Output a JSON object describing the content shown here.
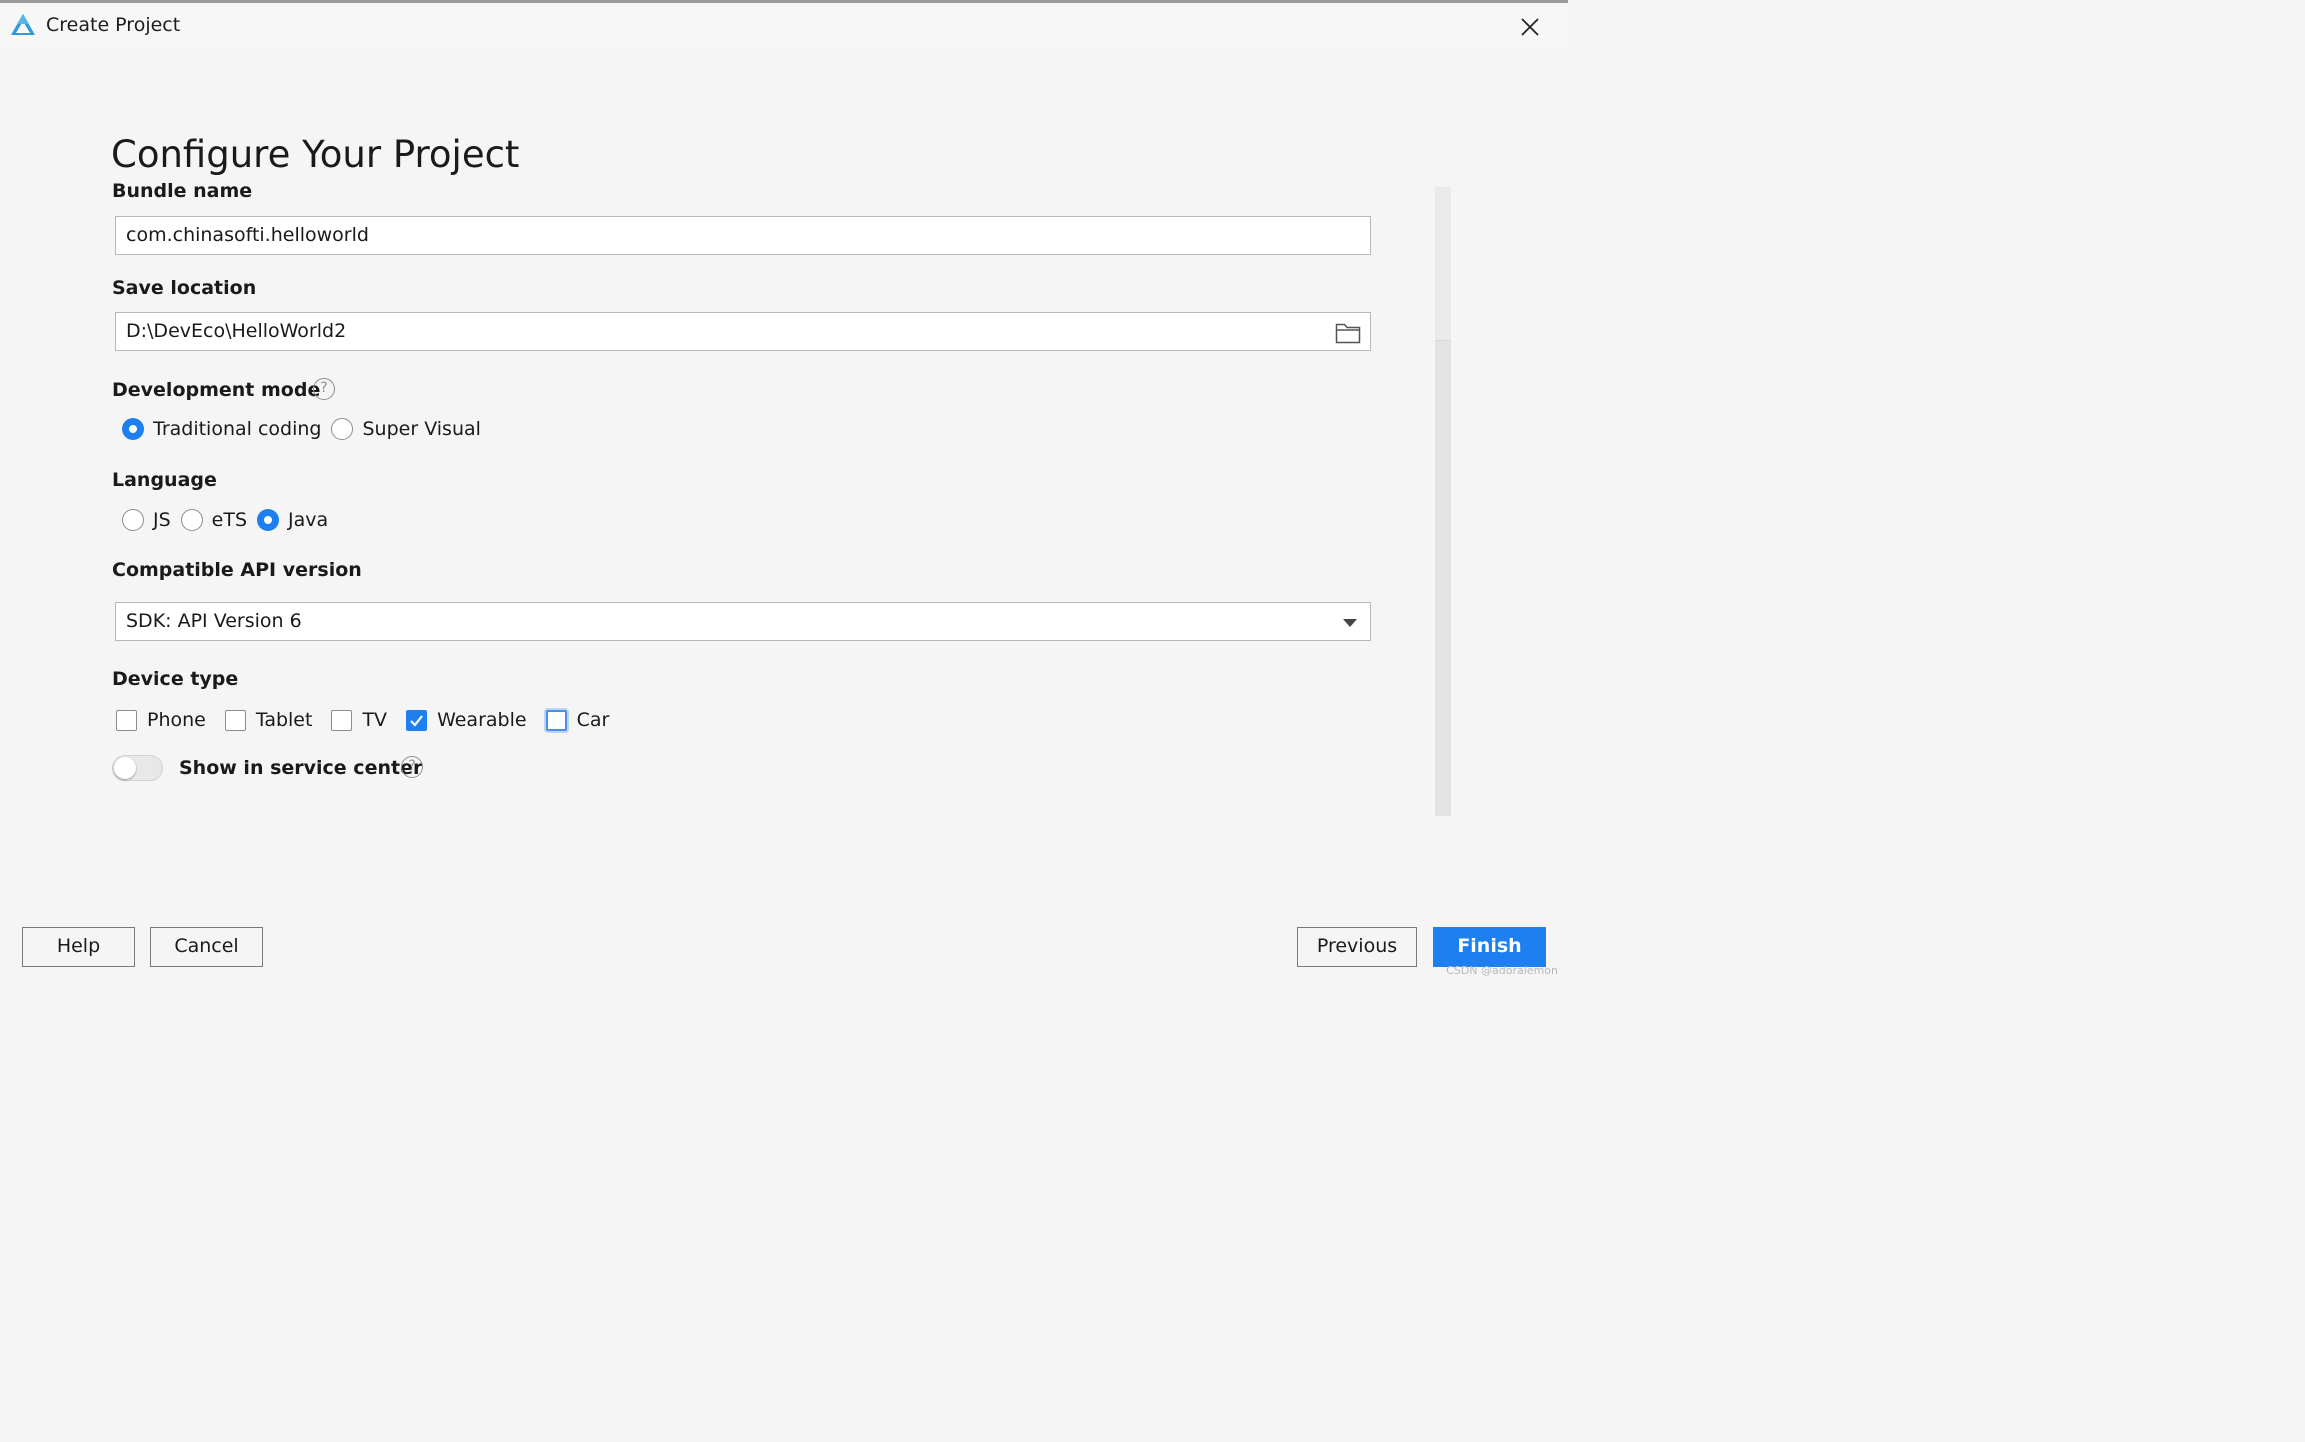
{
  "window": {
    "title": "Create Project",
    "logo_icon": "deveco-triangle-logo",
    "close_icon": "close-x-icon"
  },
  "page": {
    "heading": "Configure Your Project"
  },
  "form": {
    "bundle_name": {
      "label": "Bundle name",
      "value": "com.chinasofti.helloworld"
    },
    "save_location": {
      "label": "Save location",
      "value": "D:\\DevEco\\HelloWorld2",
      "browse_icon": "folder-icon"
    },
    "development_mode": {
      "label": "Development mode",
      "help_icon": "?",
      "options": [
        {
          "label": "Traditional coding",
          "checked": true
        },
        {
          "label": "Super Visual",
          "checked": false
        }
      ]
    },
    "language": {
      "label": "Language",
      "options": [
        {
          "label": "JS",
          "checked": false
        },
        {
          "label": "eTS",
          "checked": false
        },
        {
          "label": "Java",
          "checked": true
        }
      ]
    },
    "api_version": {
      "label": "Compatible API version",
      "selected": "SDK: API Version 6",
      "caret_icon": "chevron-down-icon"
    },
    "device_type": {
      "label": "Device type",
      "options": [
        {
          "label": "Phone",
          "checked": false
        },
        {
          "label": "Tablet",
          "checked": false
        },
        {
          "label": "TV",
          "checked": false
        },
        {
          "label": "Wearable",
          "checked": true
        },
        {
          "label": "Car",
          "checked": false,
          "focused": true
        }
      ]
    },
    "service_center": {
      "label": "Show in service center",
      "enabled": false,
      "help_icon": "?"
    }
  },
  "buttons": {
    "help": "Help",
    "cancel": "Cancel",
    "previous": "Previous",
    "finish": "Finish"
  },
  "watermark": "CSDN @adoralemon",
  "colors": {
    "accent": "#1e7ff0",
    "background": "#f5f5f5"
  }
}
